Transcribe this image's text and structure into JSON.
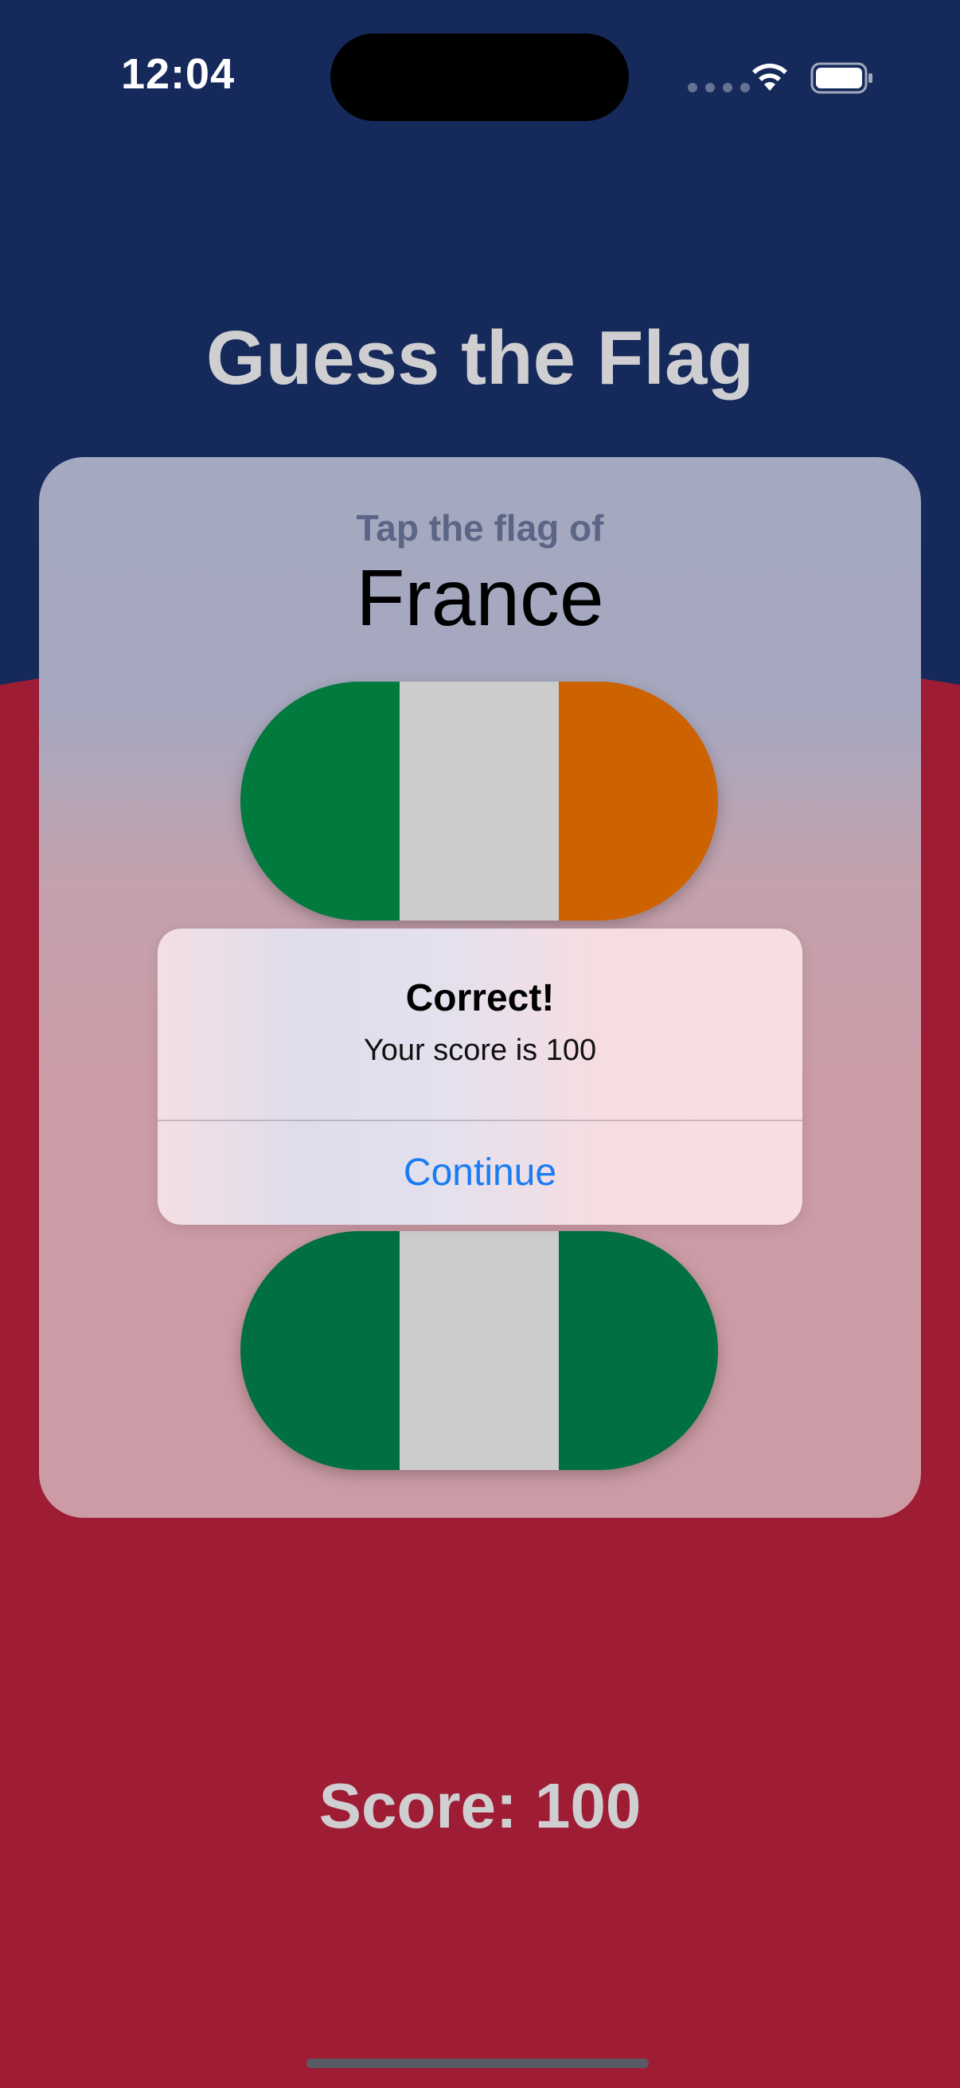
{
  "status_bar": {
    "time": "12:04",
    "icons": [
      "signal-dots-icon",
      "wifi-icon",
      "battery-icon"
    ]
  },
  "app": {
    "title": "Guess the Flag"
  },
  "card": {
    "prompt": "Tap the flag of",
    "country": "France"
  },
  "flags": [
    {
      "stripes": [
        "#007a3d",
        "#cccccc",
        "#cc6300"
      ]
    },
    {
      "stripes": [
        "#007040",
        "#cccccc",
        "#007040"
      ]
    }
  ],
  "alert": {
    "title": "Correct!",
    "message": "Your score is 100",
    "button_label": "Continue"
  },
  "footer": {
    "score_text": "Score: 100"
  },
  "colors": {
    "background_top": "#15295b",
    "background_bottom": "#9e1d35",
    "alert_button": "#1a7cf2"
  }
}
